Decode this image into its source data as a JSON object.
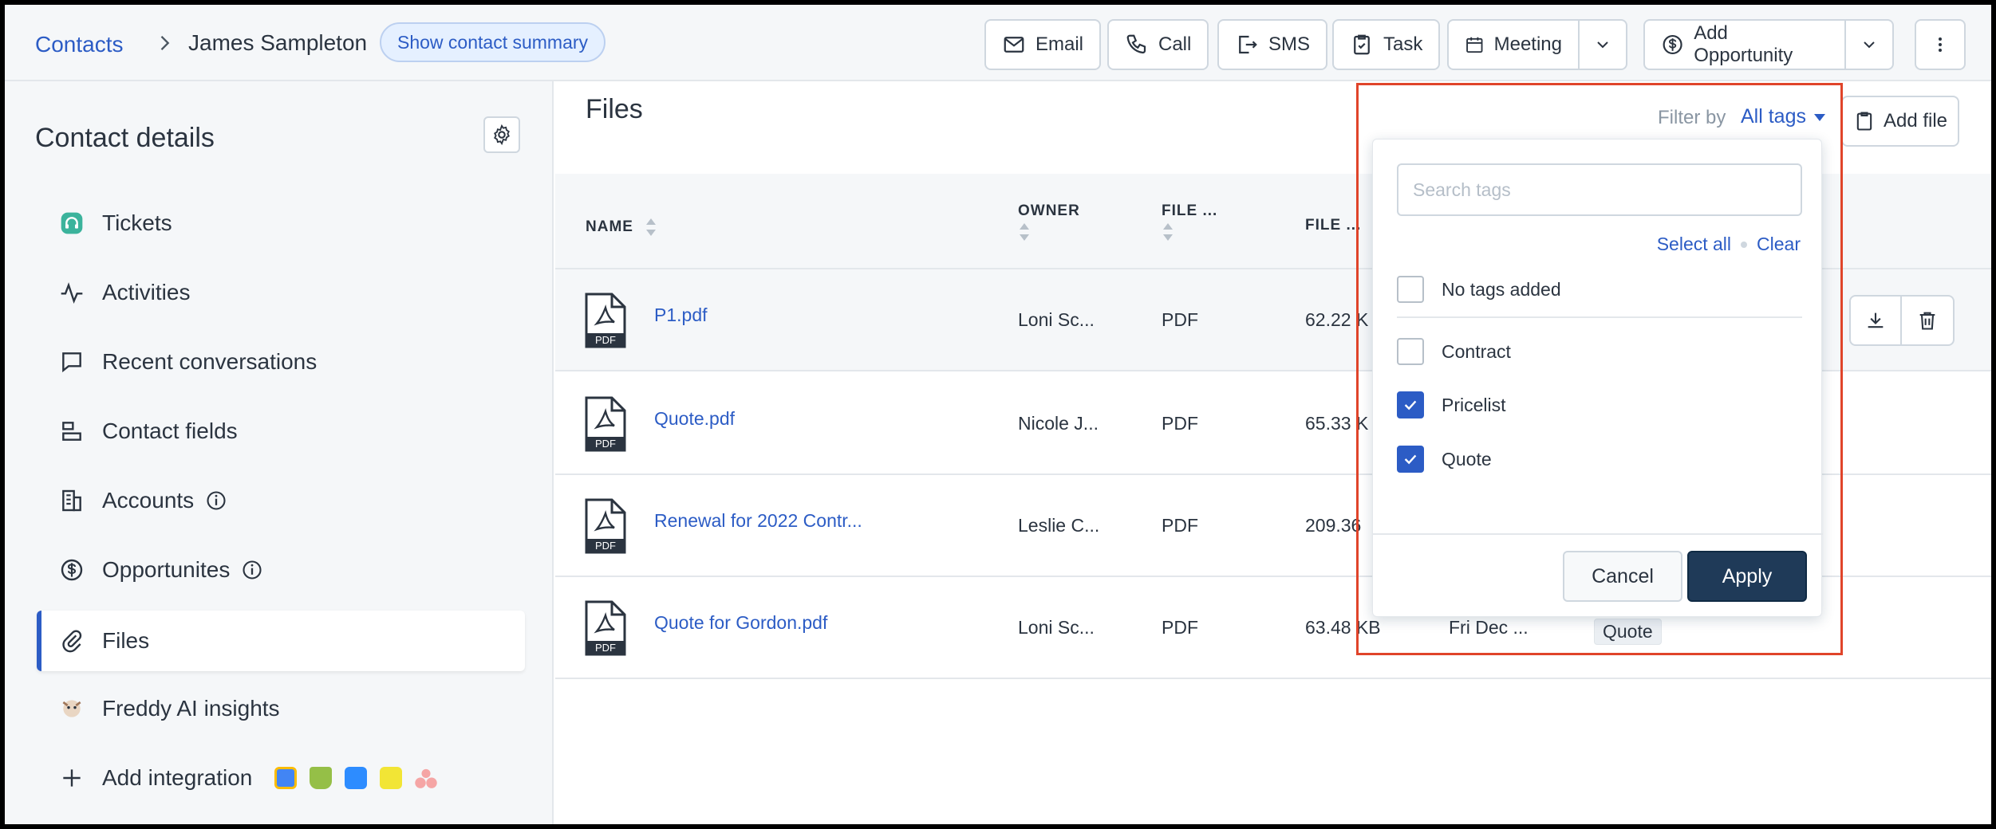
{
  "header": {
    "breadcrumb_root": "Contacts",
    "contact_name": "James Sampleton",
    "summary_button": "Show contact summary",
    "actions": {
      "email": "Email",
      "call": "Call",
      "sms": "SMS",
      "task": "Task",
      "meeting": "Meeting",
      "add_opportunity": "Add Opportunity"
    }
  },
  "sidebar": {
    "title": "Contact details",
    "items": [
      {
        "label": "Tickets",
        "icon": "headset-icon"
      },
      {
        "label": "Activities",
        "icon": "activity-icon"
      },
      {
        "label": "Recent conversations",
        "icon": "chat-icon"
      },
      {
        "label": "Contact fields",
        "icon": "fields-icon"
      },
      {
        "label": "Accounts",
        "icon": "building-icon"
      },
      {
        "label": "Opportunites",
        "icon": "dollar-icon"
      },
      {
        "label": "Files",
        "icon": "paperclip-icon"
      },
      {
        "label": "Freddy AI insights",
        "icon": "freddy-icon"
      },
      {
        "label": "Add integration",
        "icon": "plus-icon"
      }
    ],
    "active_item": "Files"
  },
  "main": {
    "title": "Files",
    "add_file": "Add file",
    "filter": {
      "label": "Filter by",
      "value": "All tags"
    },
    "table": {
      "columns": [
        "NAME",
        "OWNER",
        "FILE ...",
        "FILE ..."
      ],
      "rows": [
        {
          "name": "P1.pdf",
          "owner": "Loni Sc...",
          "type": "PDF",
          "size": "62.22 K",
          "date": "",
          "tag": ""
        },
        {
          "name": "Quote.pdf",
          "owner": "Nicole J...",
          "type": "PDF",
          "size": "65.33 K",
          "date": "",
          "tag": ""
        },
        {
          "name": "Renewal for 2022 Contr...",
          "owner": "Leslie C...",
          "type": "PDF",
          "size": "209.36",
          "date": "",
          "tag": ""
        },
        {
          "name": "Quote for Gordon.pdf",
          "owner": "Loni Sc...",
          "type": "PDF",
          "size": "63.48 KB",
          "date": "Fri Dec ...",
          "tag": "Quote"
        }
      ],
      "file_badge": "PDF"
    }
  },
  "tag_dropdown": {
    "search_placeholder": "Search tags",
    "select_all": "Select all",
    "clear": "Clear",
    "options": [
      {
        "label": "No tags added",
        "checked": false
      },
      {
        "label": "Contract",
        "checked": false
      },
      {
        "label": "Pricelist",
        "checked": true
      },
      {
        "label": "Quote",
        "checked": true
      }
    ],
    "cancel": "Cancel",
    "apply": "Apply"
  },
  "colors": {
    "accent": "#2c5cc5",
    "primary_button": "#1f3a58",
    "highlight_box": "#e0442a"
  }
}
